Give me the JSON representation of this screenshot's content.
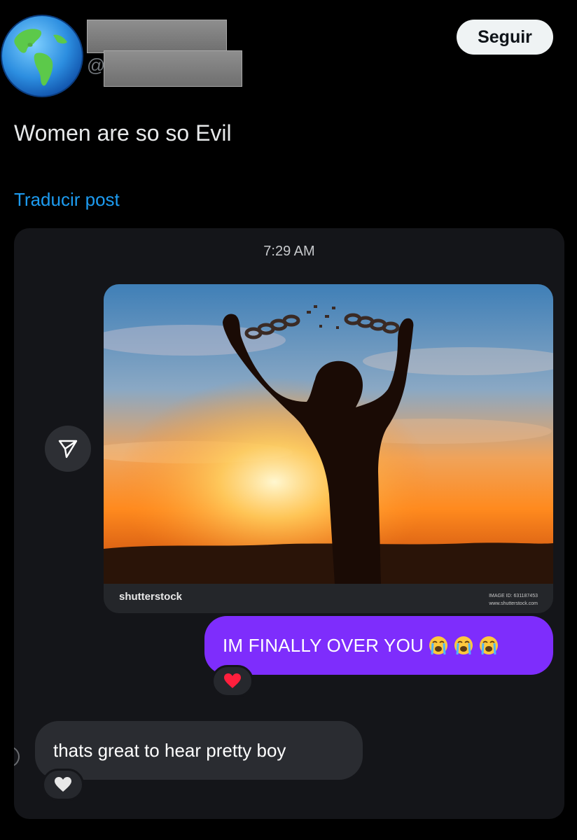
{
  "header": {
    "handle_prefix": "@",
    "follow_label": "Seguir"
  },
  "post": {
    "text": "Women are so so Evil",
    "translate_label": "Traducir post"
  },
  "dm": {
    "timestamp": "7:29 AM",
    "image": {
      "logo_text": "shutterstock",
      "image_id": "IMAGE ID: 631187453",
      "site": "www.shutterstock.com"
    },
    "sent_message": "IM FINALLY OVER YOU",
    "sent_emojis": [
      "loudly-crying-face",
      "loudly-crying-face",
      "loudly-crying-face"
    ],
    "sent_reaction": "red-heart",
    "received_message": "thats great to hear pretty boy",
    "received_reaction": "white-heart"
  },
  "colors": {
    "background": "#000000",
    "follow_button_bg": "#eff3f4",
    "link": "#1d9bf0",
    "dm_card_bg": "#141519",
    "sent_bubble": "#7e2dfc",
    "received_bubble": "#2a2c31"
  }
}
